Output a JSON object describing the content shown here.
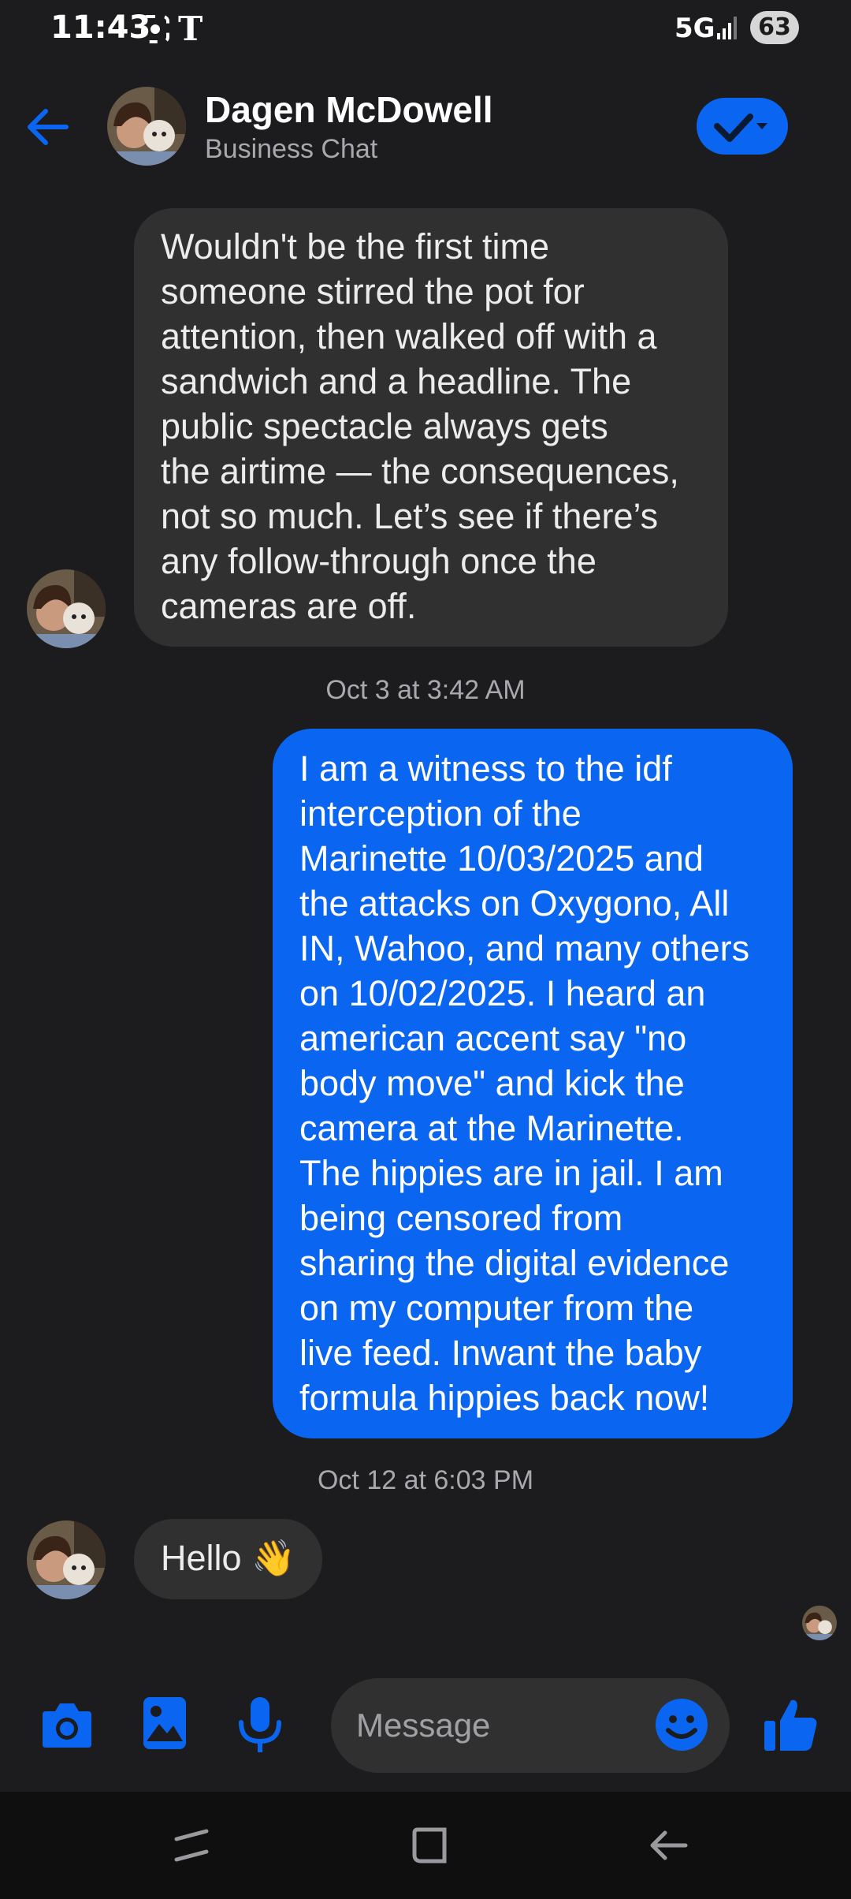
{
  "status_bar": {
    "time": "11:43",
    "carrier_icon": "T",
    "network": "5G",
    "battery": "63"
  },
  "header": {
    "contact_name": "Dagen McDowell",
    "subtitle": "Business Chat"
  },
  "messages": [
    {
      "direction": "incoming",
      "text": "Wouldn't be the first time\nsomeone stirred the pot for\nattention, then walked off with a\nsandwich and a headline. The\npublic spectacle always gets\nthe airtime — the consequences,\nnot so much. Let’s see if there’s\nany follow-through once the\ncameras are off."
    },
    {
      "timestamp": "Oct 3 at 3:42 AM"
    },
    {
      "direction": "outgoing",
      "text": "I am a witness to the idf\ninterception of the\nMarinette 10/03/2025 and\nthe attacks on Oxygono,  All\nIN, Wahoo, and many others\non 10/02/2025. I heard an\namerican accent say \"no\nbody move\" and kick the\ncamera at the Marinette.\nThe hippies are in jail. I am\nbeing censored from\nsharing the digital evidence\non my computer from the\nlive feed. Inwant the baby\nformula hippies back now!"
    },
    {
      "timestamp": "Oct 12 at 6:03 PM"
    },
    {
      "direction": "incoming",
      "text": "Hello 👋"
    }
  ],
  "composer": {
    "placeholder": "Message"
  },
  "colors": {
    "accent": "#0a66f0",
    "background": "#1c1c1e",
    "incoming_bubble": "#303030"
  },
  "icons": {
    "back": "arrow-left-icon",
    "verify": "checkmark-dropdown-icon",
    "camera": "camera-icon",
    "gallery": "image-icon",
    "mic": "microphone-icon",
    "emoji": "smiley-icon",
    "like": "thumbs-up-icon"
  }
}
